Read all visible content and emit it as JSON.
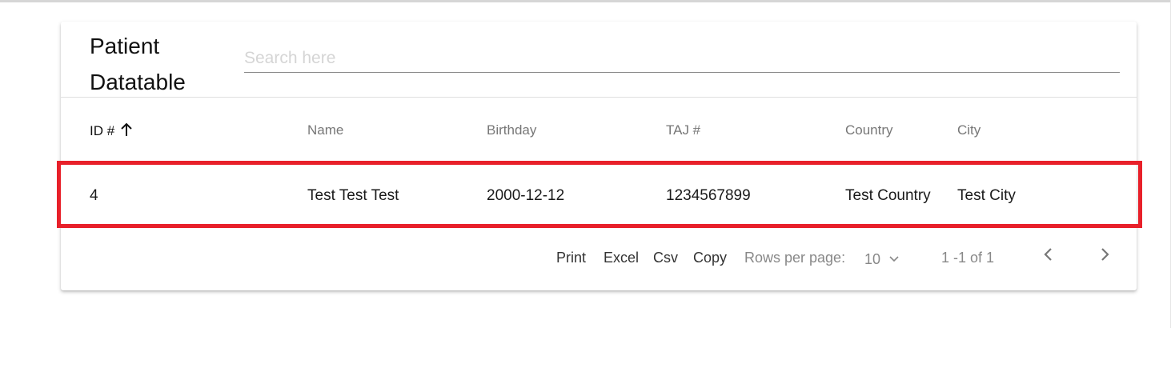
{
  "header": {
    "title": "Patient Datatable",
    "search_placeholder": "Search here",
    "search_value": ""
  },
  "table": {
    "columns": [
      {
        "key": "id",
        "label": "ID #",
        "sorted": "asc"
      },
      {
        "key": "name",
        "label": "Name"
      },
      {
        "key": "birthday",
        "label": "Birthday"
      },
      {
        "key": "taj",
        "label": "TAJ #"
      },
      {
        "key": "country",
        "label": "Country"
      },
      {
        "key": "city",
        "label": "City"
      }
    ],
    "rows": [
      {
        "id": "4",
        "name": "Test Test Test",
        "birthday": "2000-12-12",
        "taj": "1234567899",
        "country": "Test Country",
        "city": "Test City"
      }
    ]
  },
  "footer": {
    "print_label": "Print",
    "excel_label": "Excel",
    "csv_label": "Csv",
    "copy_label": "Copy",
    "rows_per_page_label": "Rows per page:",
    "rows_per_page_value": "10",
    "range_text": "1 -1 of 1"
  },
  "colors": {
    "highlight_border": "#e8202a",
    "header_text": "#777777"
  },
  "icons": {
    "sort": "arrow-up-icon",
    "dropdown": "chevron-down-icon",
    "prev": "chevron-left-icon",
    "next": "chevron-right-icon"
  }
}
